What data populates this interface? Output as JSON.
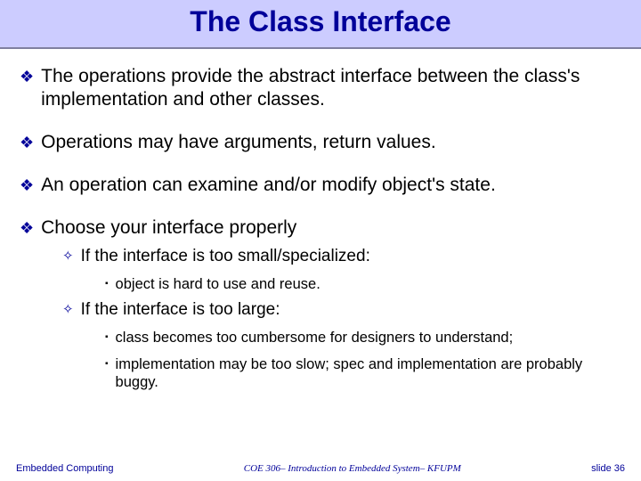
{
  "title": "The Class Interface",
  "bullets": [
    {
      "text": "The operations provide the abstract interface between the class's implementation and other classes.",
      "children": []
    },
    {
      "text": "Operations may have arguments, return values.",
      "children": []
    },
    {
      "text": "An operation can examine and/or modify object's state.",
      "children": []
    },
    {
      "text": "Choose your interface properly",
      "children": [
        {
          "text": "If the interface is too small/specialized:",
          "children": [
            {
              "text": "object is hard to use and reuse."
            }
          ]
        },
        {
          "text": "If the interface is too large:",
          "children": [
            {
              "text": "class becomes too cumbersome for designers to understand;"
            },
            {
              "text": "implementation may be too slow; spec and implementation are probably buggy."
            }
          ]
        }
      ]
    }
  ],
  "footer": {
    "left": "Embedded Computing",
    "center": "COE 306– Introduction to Embedded System– KFUPM",
    "right": "slide 36"
  },
  "markers": {
    "l1": "❖",
    "l2": "✧",
    "l3": "▪"
  }
}
